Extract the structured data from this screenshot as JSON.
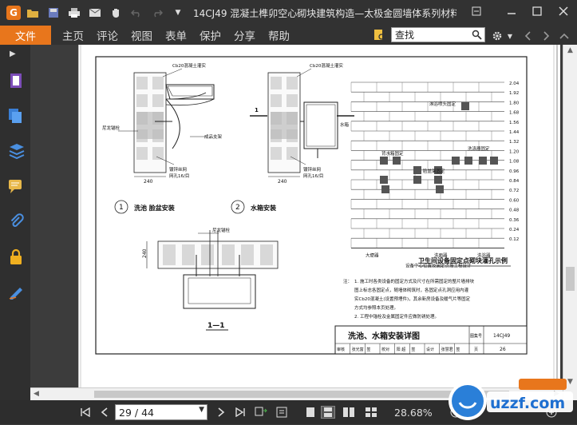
{
  "window": {
    "title": "14CJ49 混凝土榫卯空心砌块建筑构造—太极金圆墙体系列材料 ....",
    "app_logo": "G"
  },
  "menu": {
    "file": "文件",
    "items": [
      "主页",
      "评论",
      "视图",
      "表单",
      "保护",
      "分享",
      "帮助"
    ],
    "search_label": "查找"
  },
  "drawing": {
    "labels": {
      "cb20_a": "Cb20混凝土灌实",
      "cb20_b": "Cb20混凝土灌实",
      "nylon_a": "尼龙锚栓",
      "finished_bracket": "成品支架",
      "wire_mesh_a": "镀锌丝网",
      "mesh_spec_a": "网孔16/目",
      "water_tank": "水箱",
      "wire_mesh_b": "镀锌丝网",
      "mesh_spec_b": "网孔16/目",
      "dim_240_a": "240",
      "dim_240_b": "240",
      "dim_240_c": "240",
      "section_mark": "1",
      "sub1_num": "1",
      "sub1_title": "洗池   脸盆安装",
      "sub2_num": "2",
      "sub2_title": "水箱安装",
      "nylon_b": "尼龙锚栓",
      "section_title": "1—1"
    },
    "grid": {
      "heights": [
        "2.04",
        "1.92",
        "1.80",
        "1.68",
        "1.56",
        "1.44",
        "1.32",
        "1.20",
        "1.08",
        "0.96",
        "0.84",
        "0.72",
        "0.60",
        "0.48",
        "0.36",
        "0.24",
        "0.12"
      ],
      "annot_shower_head": "淋浴喷头固定",
      "annot_tank": "背水箱固定",
      "annot_washer": "洗涤器固定",
      "annot_basin": "脸盆架固定",
      "bottom_labels": [
        "大便器",
        "洗面器",
        "洗浴器"
      ],
      "bottom_caption": "设备中心位置及固定点按工程设计",
      "title": "卫生间设备固定点砌块灌孔示例"
    },
    "notes": {
      "prefix": "注：",
      "items": [
        "1. 施工时各类设备的固定方式及尺寸在所需固定的整片墙排块",
        "   图上标志各固定点，随墙体砌筑时，各固定点孔洞应用内灌",
        "   实Cb20混凝土(设置预埋件)，其余新房设备及暖气片等固定",
        "   方式均参照本页处理。",
        "2. 工程中锚栓及金属固定件应做防锈处理。"
      ]
    },
    "title_block": {
      "title": "洗池、水箱安装详图",
      "atlas_label": "图集号",
      "atlas_no": "14CJ49",
      "page_label": "页",
      "page_no": "26",
      "row": [
        "审核",
        "张光富",
        "签",
        "校对",
        "阳 超",
        "签",
        "设计",
        "张慧君",
        "签"
      ]
    }
  },
  "navigation": {
    "page_value": "29 / 44",
    "zoom": "28.68%"
  },
  "colors": {
    "accent": "#e8761c",
    "chrome": "#323232"
  }
}
